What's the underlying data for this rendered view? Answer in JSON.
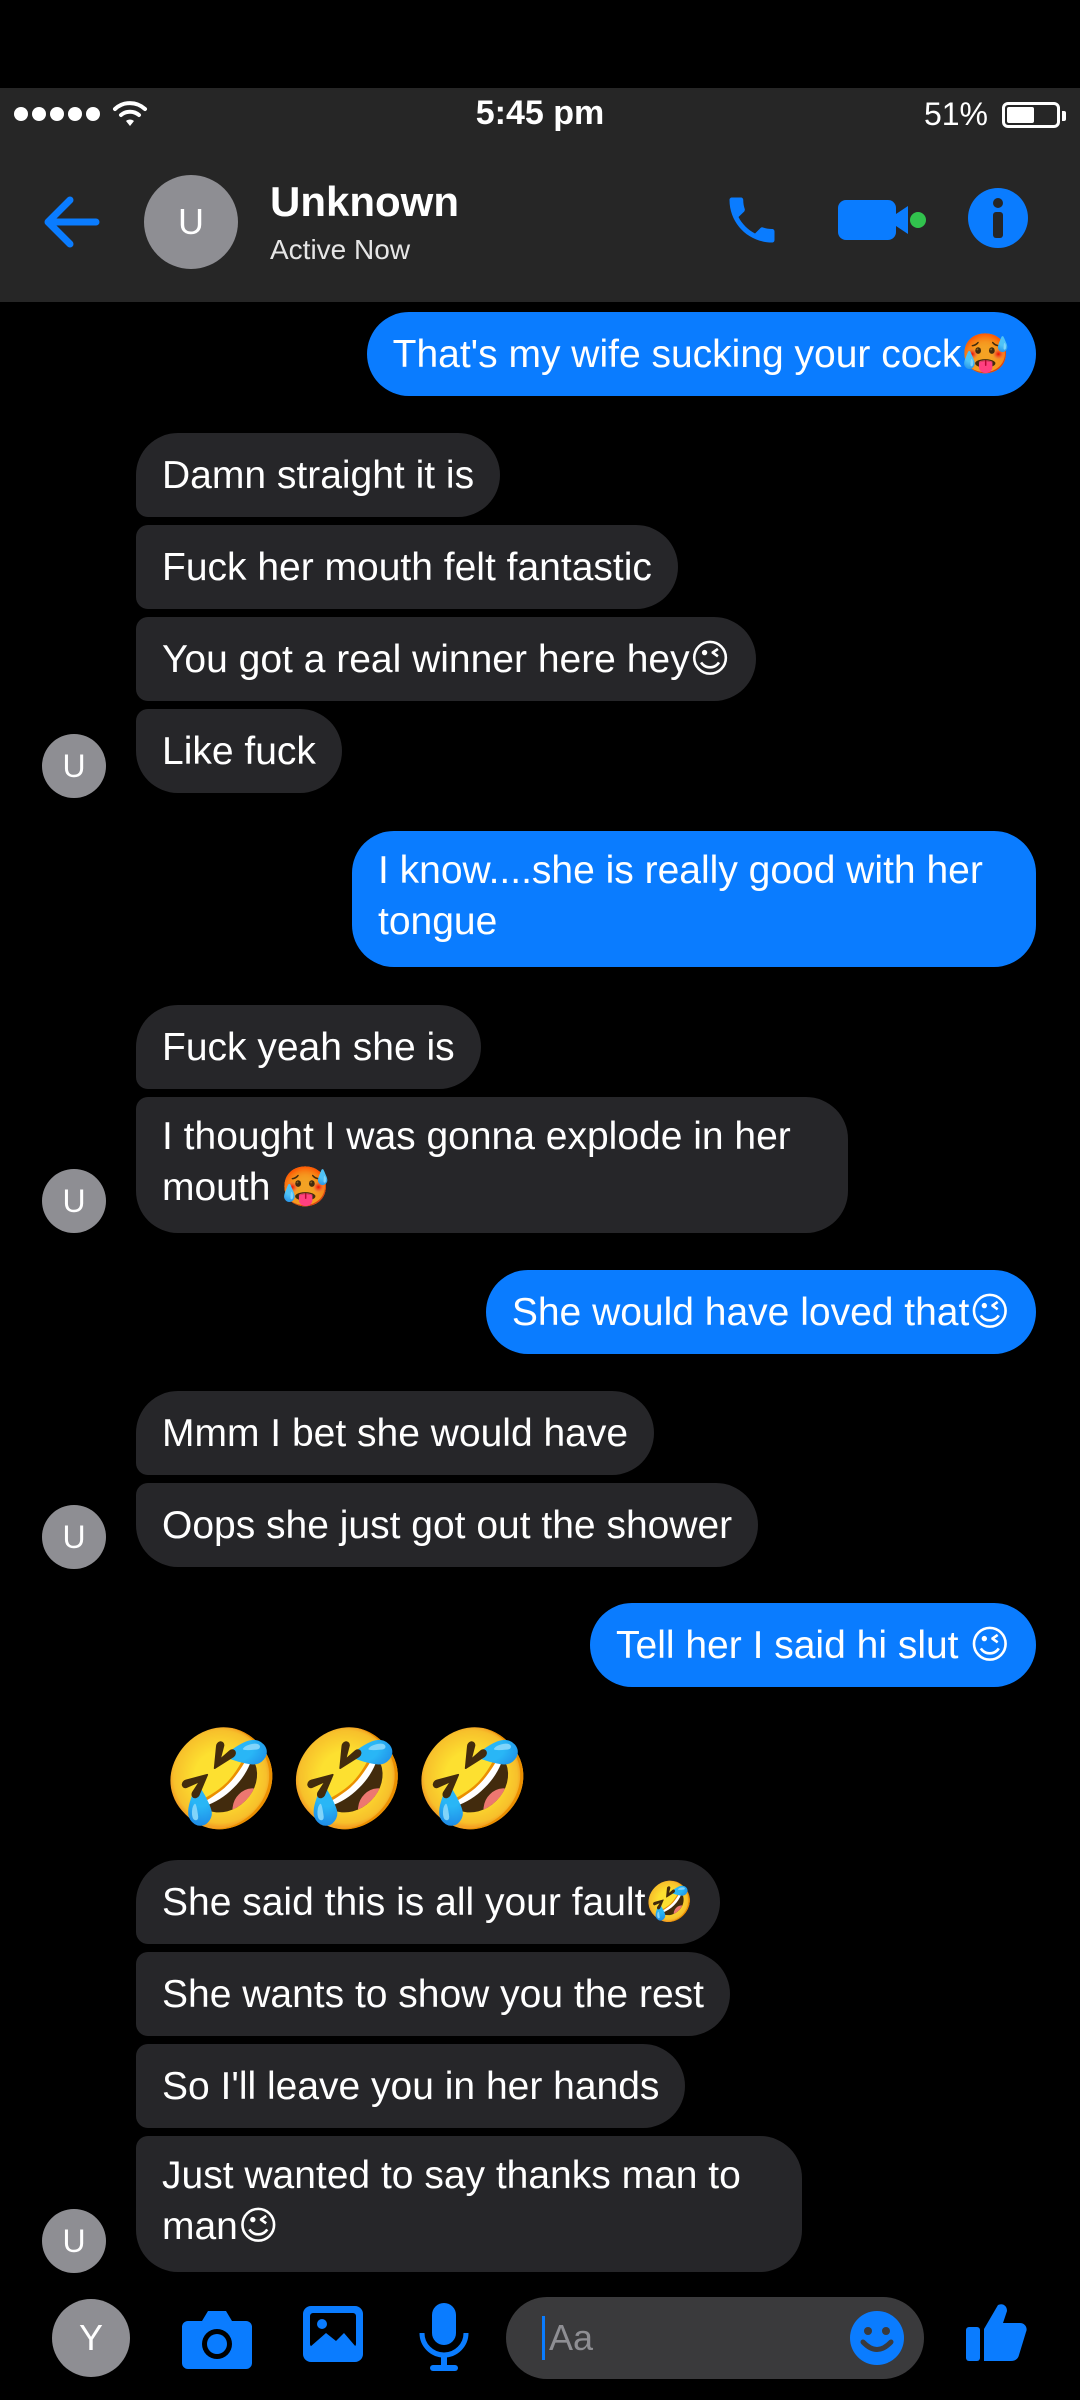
{
  "status_bar": {
    "time": "5:45 pm",
    "battery": "51%",
    "battery_level": 0.51
  },
  "header": {
    "avatar_initial": "U",
    "name": "Unknown",
    "status": "Active Now"
  },
  "colors": {
    "accent": "#0a7cff",
    "incoming_bubble": "#262629",
    "header_bg": "#262626",
    "video_dot": "#31c24d"
  },
  "messages": [
    {
      "dir": "out",
      "text": "That's my wife sucking your cock🥵"
    },
    {
      "dir": "in",
      "text": "Damn straight it is"
    },
    {
      "dir": "in",
      "text": "Fuck her mouth felt fantastic"
    },
    {
      "dir": "in",
      "text": "You got a real winner here hey😉"
    },
    {
      "dir": "in",
      "text": "Like fuck"
    },
    {
      "dir": "out",
      "text": "I know....she is really good with her tongue"
    },
    {
      "dir": "in",
      "text": "Fuck yeah she is"
    },
    {
      "dir": "in",
      "text": "I thought I was gonna explode in her mouth 🥵"
    },
    {
      "dir": "out",
      "text": "She would have loved that😉"
    },
    {
      "dir": "in",
      "text": "Mmm I bet she would have"
    },
    {
      "dir": "in",
      "text": "Oops she just got out the shower"
    },
    {
      "dir": "out",
      "text": "Tell her I said hi slut 😉"
    },
    {
      "dir": "in",
      "text": "🤣🤣🤣"
    },
    {
      "dir": "in",
      "text": "She said this is all your fault🤣"
    },
    {
      "dir": "in",
      "text": "She wants to show you the rest"
    },
    {
      "dir": "in",
      "text": "So I'll leave you in her hands"
    },
    {
      "dir": "in",
      "text": "Just wanted to say thanks man to man😉"
    }
  ],
  "contact_avatar_initial": "U",
  "composer": {
    "me_initial": "Y",
    "placeholder": "Aa"
  },
  "icons": {
    "back": "arrow-left-icon",
    "phone": "phone-icon",
    "video": "video-camera-icon",
    "info": "info-icon",
    "camera": "camera-icon",
    "gallery": "image-icon",
    "mic": "microphone-icon",
    "emoji": "smiley-icon",
    "like": "thumbs-up-icon"
  }
}
